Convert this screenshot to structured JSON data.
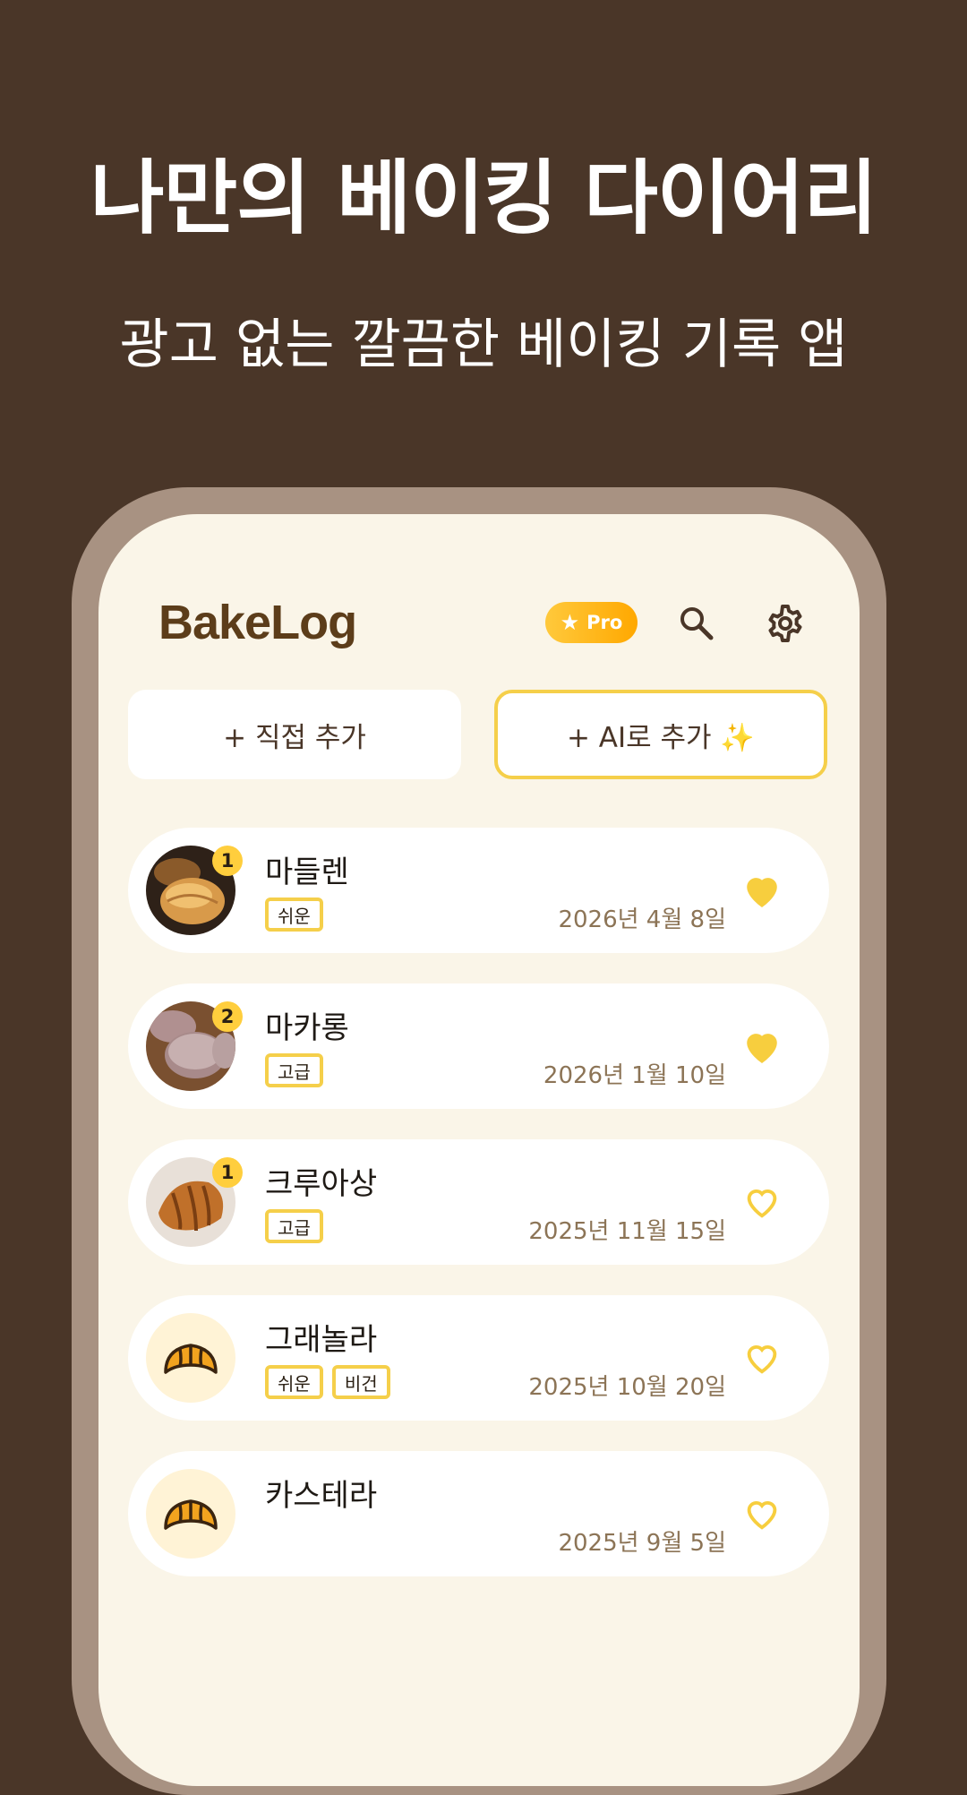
{
  "hero": {
    "title": "나만의 베이킹 다이어리",
    "subtitle": "광고 없는 깔끔한 베이킹 기록 앱"
  },
  "app": {
    "logo": "BakeLog",
    "pro_label": "Pro",
    "search_icon": "search-icon",
    "settings_icon": "gear-icon"
  },
  "actions": {
    "manual_add": "+ 직접 추가",
    "ai_add": "+ AI로 추가 ✨"
  },
  "colors": {
    "background": "#4a3628",
    "screen": "#faf5e8",
    "accent": "#f5cf4a",
    "logo": "#5c3d1a"
  },
  "items": [
    {
      "name": "마들렌",
      "tags": [
        "쉬운"
      ],
      "date": "2026년 4월 8일",
      "count": "1",
      "favorite": true,
      "thumb": "madeleine-photo"
    },
    {
      "name": "마카롱",
      "tags": [
        "고급"
      ],
      "date": "2026년 1월 10일",
      "count": "2",
      "favorite": true,
      "thumb": "macaron-photo"
    },
    {
      "name": "크루아상",
      "tags": [
        "고급"
      ],
      "date": "2025년 11월 15일",
      "count": "1",
      "favorite": false,
      "thumb": "croissant-photo"
    },
    {
      "name": "그래놀라",
      "tags": [
        "쉬운",
        "비건"
      ],
      "date": "2025년 10월 20일",
      "count": null,
      "favorite": false,
      "thumb": "croissant-icon"
    },
    {
      "name": "카스테라",
      "tags": [],
      "date": "2025년 9월 5일",
      "count": null,
      "favorite": false,
      "thumb": "croissant-icon"
    }
  ]
}
